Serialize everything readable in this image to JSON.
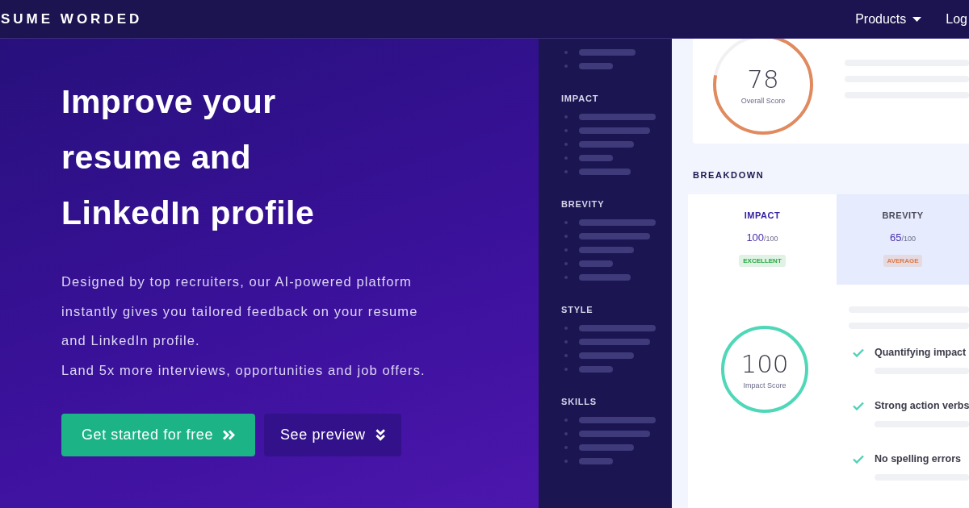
{
  "nav": {
    "logo": "SUME WORDED",
    "items": [
      {
        "label": "Products",
        "dropdown": true
      },
      {
        "label": "Log",
        "dropdown": false
      }
    ]
  },
  "hero": {
    "title": "Improve your resume and LinkedIn profile",
    "paragraphs": [
      "Designed by top recruiters, our AI-powered platform instantly gives you tailored feedback on your resume and LinkedIn profile.",
      "Land 5x more interviews, opportunities and job offers."
    ],
    "buttons": [
      {
        "label": "Get started for free",
        "kind": "primary"
      },
      {
        "label": "See preview",
        "kind": "secondary"
      }
    ]
  },
  "sidebar": {
    "sections": [
      {
        "heading": "IMPACT"
      },
      {
        "heading": "BREVITY"
      },
      {
        "heading": "STYLE"
      },
      {
        "heading": "SKILLS"
      }
    ]
  },
  "overall_score": {
    "value": "78",
    "label": "Overall Score",
    "level": 0.78
  },
  "breakdown": {
    "heading": "BREAKDOWN",
    "categories": [
      {
        "name": "IMPACT",
        "score": "100",
        "out_of": "/100",
        "badge": "EXCELLENT",
        "color": "#27a844",
        "selected": true
      },
      {
        "name": "BREVITY",
        "score": "65",
        "out_of": "/100",
        "badge": "AVERAGE",
        "color": "#e07b45",
        "selected": false
      }
    ]
  },
  "impact_score": {
    "value": "100",
    "label": "Impact Score",
    "level": 1.0
  },
  "checks": [
    {
      "label": "Quantifying impact",
      "checked": true
    },
    {
      "label": "Strong action verbs",
      "checked": true
    },
    {
      "label": "No spelling errors",
      "checked": true
    }
  ]
}
